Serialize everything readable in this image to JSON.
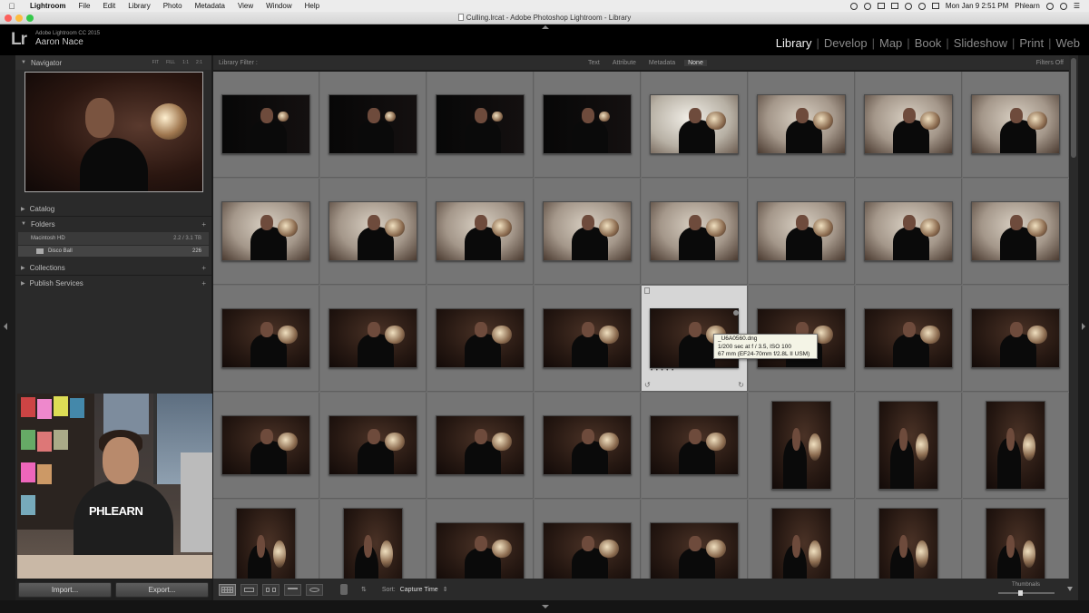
{
  "menubar": {
    "app": "Lightroom",
    "items": [
      "File",
      "Edit",
      "Library",
      "Photo",
      "Metadata",
      "View",
      "Window",
      "Help"
    ],
    "clock": "Mon Jan 9  2:51 PM",
    "user": "Phlearn"
  },
  "window": {
    "title": "Culling.lrcat - Adobe Photoshop Lightroom - Library"
  },
  "identity": {
    "logo": "Lr",
    "version": "Adobe Lightroom CC 2015",
    "user": "Aaron Nace"
  },
  "modules": [
    "Library",
    "Develop",
    "Map",
    "Book",
    "Slideshow",
    "Print",
    "Web"
  ],
  "active_module": "Library",
  "left_panel": {
    "navigator": {
      "title": "Navigator",
      "options": [
        "FIT",
        "FILL",
        "1:1",
        "2:1"
      ]
    },
    "catalog": "Catalog",
    "folders": {
      "title": "Folders",
      "volume": "Macintosh HD",
      "volume_info": "2.2 / 3.1 TB",
      "items": [
        {
          "name": "Disco Ball",
          "count": "226"
        }
      ]
    },
    "collections": "Collections",
    "publish": "Publish Services",
    "import_label": "Import...",
    "export_label": "Export..."
  },
  "webcam": {
    "shirt_text": "PHLEARN"
  },
  "filter_bar": {
    "label": "Library Filter :",
    "options": [
      "Text",
      "Attribute",
      "Metadata",
      "None"
    ],
    "selected": "None",
    "status": "Filters Off"
  },
  "tooltip": {
    "line1": "_U6A0560.dng",
    "line2": "1/200 sec at f / 3.5, ISO 100",
    "line3": "67 mm (EF24-70mm f/2.8L II USM)"
  },
  "toolbar": {
    "sort_label": "Sort:",
    "sort_value": "Capture Time",
    "thumbnails_label": "Thumbnails"
  },
  "colors": {
    "accent_active": "#f2f2f2",
    "grid_bg": "#757575",
    "selected_cell": "#d6d6d6"
  }
}
